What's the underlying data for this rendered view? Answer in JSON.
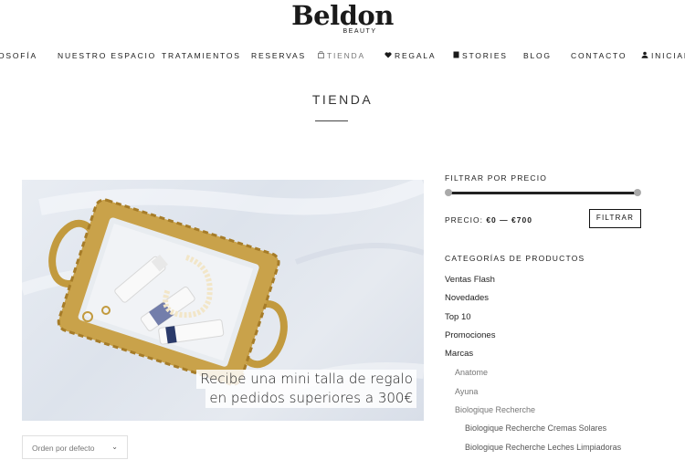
{
  "brand": {
    "name": "Beldon",
    "sub": "BEAUTY"
  },
  "nav": {
    "items": [
      {
        "label": "OSOFÍA"
      },
      {
        "label": "NUESTRO ESPACIO"
      },
      {
        "label": "TRATAMIENTOS"
      },
      {
        "label": "RESERVAS"
      },
      {
        "label": "TIENDA",
        "icon": "shopping-bag-icon"
      },
      {
        "label": "REGALA",
        "icon": "heart-icon"
      },
      {
        "label": "STORIES",
        "icon": "book-icon"
      },
      {
        "label": "BLOG"
      },
      {
        "label": "CONTACTO"
      },
      {
        "label": "INICIAR",
        "icon": "user-icon"
      }
    ]
  },
  "page": {
    "title": "TIENDA"
  },
  "hero": {
    "caption_line1": "Recibe una mini talla de regalo",
    "caption_line2": "en pedidos superiores a 300€"
  },
  "sort": {
    "label": "Orden por defecto"
  },
  "sidebar": {
    "price_filter": {
      "title": "FILTRAR POR PRECIO",
      "label": "PRECIO:",
      "range": "€0 — €700",
      "button": "FILTRAR"
    },
    "categories": {
      "title": "CATEGORÍAS DE PRODUCTOS",
      "items": [
        {
          "label": "Ventas Flash"
        },
        {
          "label": "Novedades"
        },
        {
          "label": "Top 10"
        },
        {
          "label": "Promociones"
        },
        {
          "label": "Marcas"
        },
        {
          "label": "Anatome"
        },
        {
          "label": "Ayuna"
        },
        {
          "label": "Biologique Recherche"
        },
        {
          "label": "Biologique Recherche Cremas Solares"
        },
        {
          "label": "Biologique Recherche Leches Limpiadoras"
        }
      ]
    }
  },
  "colors": {
    "text": "#222222",
    "muted": "#777777",
    "gold": "#c9a24a",
    "bg": "#ffffff"
  }
}
